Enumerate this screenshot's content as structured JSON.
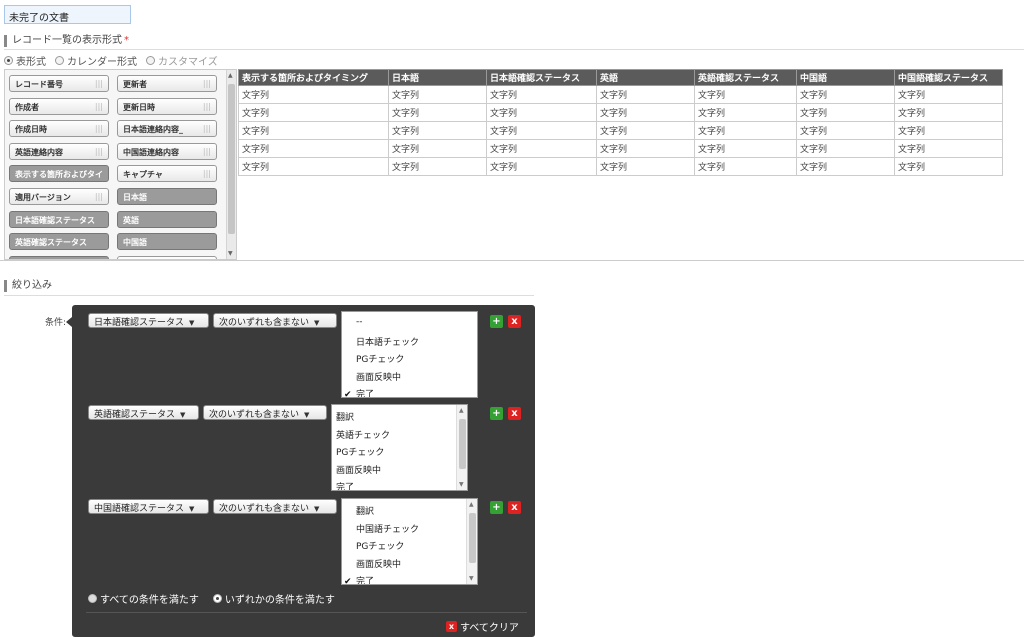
{
  "view_name": "未完了の文書",
  "display_format": {
    "label": "レコード一覧の表示形式",
    "required_mark": "*",
    "options": [
      "表形式",
      "カレンダー形式",
      "カスタマイズ"
    ],
    "selected": "表形式"
  },
  "fields": [
    {
      "label": "レコード番号",
      "used": false
    },
    {
      "label": "更新者",
      "used": false
    },
    {
      "label": "作成者",
      "used": false
    },
    {
      "label": "更新日時",
      "used": false
    },
    {
      "label": "作成日時",
      "used": false
    },
    {
      "label": "日本語連絡内容_",
      "used": false
    },
    {
      "label": "英語連絡内容",
      "used": false
    },
    {
      "label": "中国語連絡内容",
      "used": false
    },
    {
      "label": "表示する箇所およびタイ",
      "used": true
    },
    {
      "label": "キャプチャ",
      "used": false
    },
    {
      "label": "適用バージョン",
      "used": false
    },
    {
      "label": "日本語",
      "used": true
    },
    {
      "label": "日本語確認ステータス",
      "used": true
    },
    {
      "label": "英語",
      "used": true
    },
    {
      "label": "英語確認ステータス",
      "used": true
    },
    {
      "label": "中国語",
      "used": true
    }
  ],
  "grip_glyph": "|||",
  "preview": {
    "columns": [
      "表示する箇所およびタイミング",
      "日本語",
      "日本語確認ステータス",
      "英語",
      "英語確認ステータス",
      "中国語",
      "中国語確認ステータス"
    ],
    "cell_text": "文字列",
    "row_count": 5
  },
  "filter": {
    "section_label": "絞り込み",
    "cond_label": "条件:",
    "conditions": [
      {
        "field": "日本語確認ステータス",
        "operator": "次のいずれも含まない",
        "options": [
          "--",
          "日本語チェック",
          "PGチェック",
          "画面反映中",
          "完了"
        ],
        "checked": [
          "完了"
        ]
      },
      {
        "field": "英語確認ステータス",
        "operator": "次のいずれも含まない",
        "options": [
          "翻訳",
          "英語チェック",
          "PGチェック",
          "画面反映中",
          "完了"
        ],
        "checked": [
          "完了"
        ]
      },
      {
        "field": "中国語確認ステータス",
        "operator": "次のいずれも含まない",
        "options": [
          "翻訳",
          "中国語チェック",
          "PGチェック",
          "画面反映中",
          "完了"
        ],
        "checked": [
          "完了"
        ]
      }
    ],
    "match_modes": [
      "すべての条件を満たす",
      "いずれかの条件を満たす"
    ],
    "selected_mode": "いずれかの条件を満たす",
    "clear_all": "すべてクリア"
  },
  "icons": {
    "check": "✔",
    "add": "+",
    "remove": "x",
    "caret": "▼"
  }
}
